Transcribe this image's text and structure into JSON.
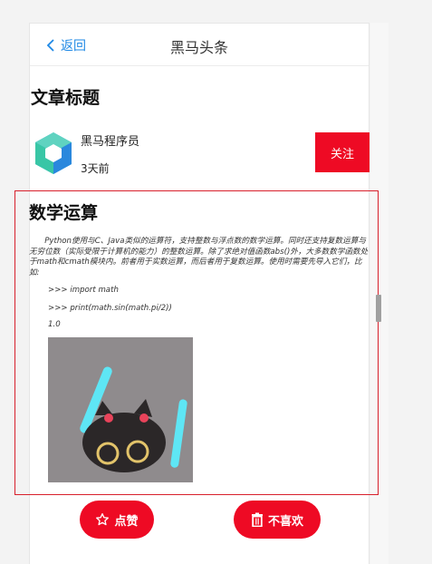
{
  "navbar": {
    "back_label": "返回",
    "title": "黑马头条"
  },
  "article": {
    "title": "文章标题",
    "author": {
      "name": "黑马程序员",
      "time": "3天前",
      "logo_icon": "heima-hexagon-logo"
    },
    "follow_label": "关注"
  },
  "content": {
    "heading": "数学运算",
    "paragraph": "Python使用与C、Java类似的运算符，支持整数与浮点数的数学运算。同时还支持复数运算与无穷位数（实际受限于计算机的能力）的整数运算。除了求绝对值函数abs()外，大多数数学函数处于math和cmath模块内。前者用于实数运算，而后者用于复数运算。使用时需要先导入它们，比如:",
    "code_lines": [
      ">>> import math",
      ">>> print(math.sin(math.pi/2))",
      "1.0"
    ],
    "image_icon": "black-cat-with-glowsticks"
  },
  "actions": {
    "like_label": "点赞",
    "like_icon": "star-icon",
    "dislike_label": "不喜欢",
    "dislike_icon": "trash-icon"
  },
  "colors": {
    "accent": "#ee0a24",
    "link": "#1e88e5",
    "highlight_border": "#d8202c"
  }
}
